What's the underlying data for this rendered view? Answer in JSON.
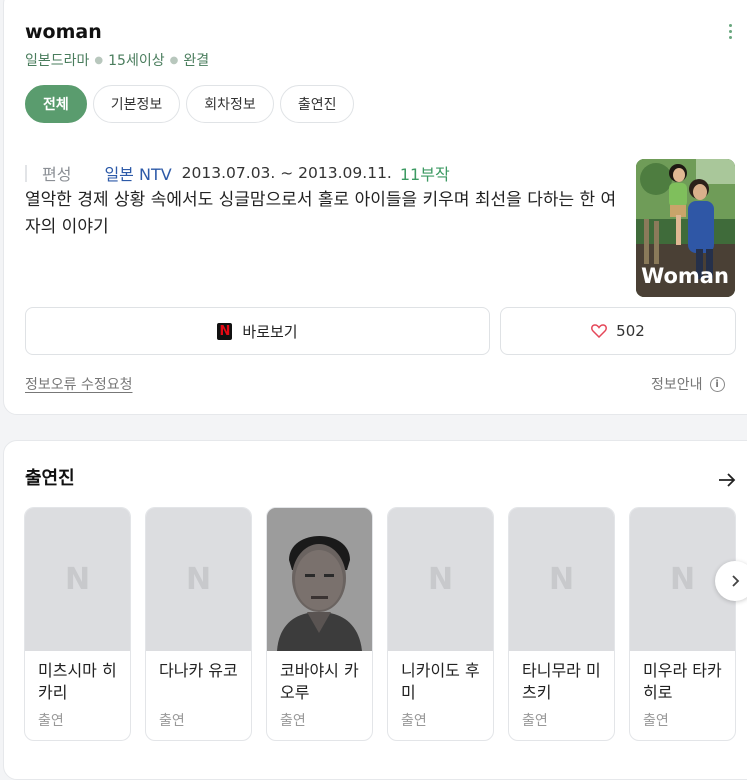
{
  "info": {
    "title": "woman",
    "meta": [
      "일본드라마",
      "15세이상",
      "완결"
    ],
    "tabs": [
      {
        "label": "전체",
        "active": true
      },
      {
        "label": "기본정보",
        "active": false
      },
      {
        "label": "회차정보",
        "active": false
      },
      {
        "label": "출연진",
        "active": false
      }
    ],
    "broadcast": {
      "label": "편성",
      "channel": "일본 NTV",
      "period": "2013.07.03. ~ 2013.09.11.",
      "episodes": "11부작"
    },
    "description": "열악한 경제 상황 속에서도 싱글맘으로서 홀로 아이들을 키우며 최선을 다하는 한 여자의 이야기",
    "poster_text": "Woman",
    "watch_label": "바로보기",
    "likes": "502",
    "report_label": "정보오류 수정요청",
    "info_guide_label": "정보안내",
    "accent_color": "#5a9c6e",
    "icons": [
      "more-vertical-icon",
      "netflix-icon",
      "heart-icon",
      "info-icon"
    ]
  },
  "cast": {
    "title": "출연진",
    "members": [
      {
        "name": "미츠시마 히카리",
        "role": "출연",
        "has_photo": false
      },
      {
        "name": "다나카 유코",
        "role": "출연",
        "has_photo": false
      },
      {
        "name": "코바야시 카오루",
        "role": "출연",
        "has_photo": true
      },
      {
        "name": "니카이도 후미",
        "role": "출연",
        "has_photo": false
      },
      {
        "name": "타니무라 미츠키",
        "role": "출연",
        "has_photo": false
      },
      {
        "name": "미우라 타카히로",
        "role": "출연",
        "has_photo": false
      }
    ],
    "icons": [
      "arrow-right-icon",
      "chevron-right-icon"
    ]
  }
}
